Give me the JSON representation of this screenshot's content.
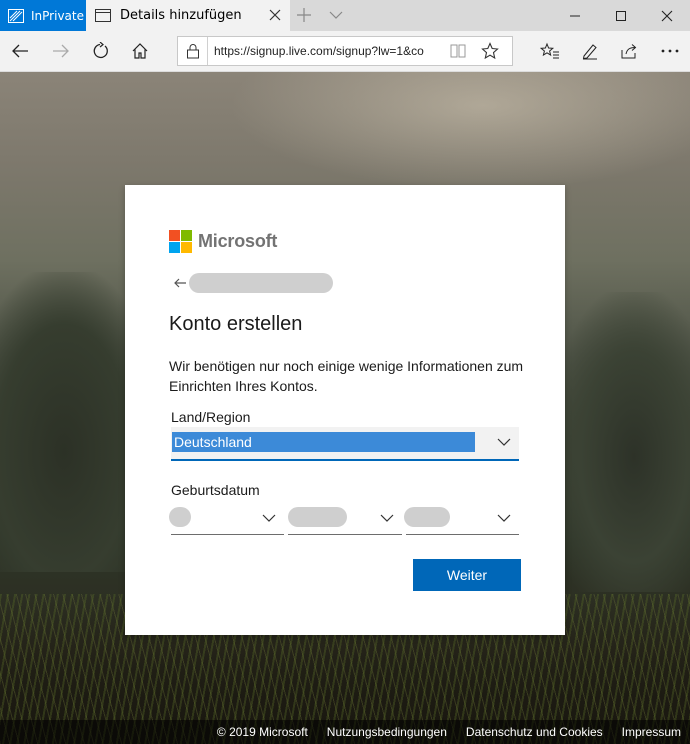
{
  "browser": {
    "inprivate_label": "InPrivate",
    "tab_title": "Details hinzufügen",
    "url": "https://signup.live.com/signup?lw=1&co",
    "colors": {
      "inprivate": "#0078d7",
      "tabbar": "#d9d9d9",
      "toolbar": "#f2f2f2"
    },
    "icons": [
      "inprivate-icon",
      "page-icon",
      "close-icon",
      "new-tab-icon",
      "tab-preview-icon",
      "minimize-icon",
      "maximize-icon",
      "window-close-icon",
      "back-icon",
      "forward-icon",
      "refresh-icon",
      "home-icon",
      "lock-icon",
      "reading-view-icon",
      "favorite-star-icon",
      "favorites-icon",
      "notes-icon",
      "share-icon",
      "more-icon"
    ]
  },
  "card": {
    "brand": "Microsoft",
    "brand_colors": [
      "#f25022",
      "#7fba00",
      "#00a4ef",
      "#ffb900"
    ],
    "title": "Konto erstellen",
    "description": "Wir benötigen nur noch einige wenige Informationen zum Einrichten Ihres Kontos.",
    "country_label": "Land/Region",
    "country_value": "Deutschland",
    "birthdate_label": "Geburtsdatum",
    "next_button": "Weiter",
    "accent": "#0067b8"
  },
  "footer": {
    "copyright": "© 2019 Microsoft",
    "terms": "Nutzungsbedingungen",
    "privacy": "Datenschutz und Cookies",
    "imprint": "Impressum"
  }
}
